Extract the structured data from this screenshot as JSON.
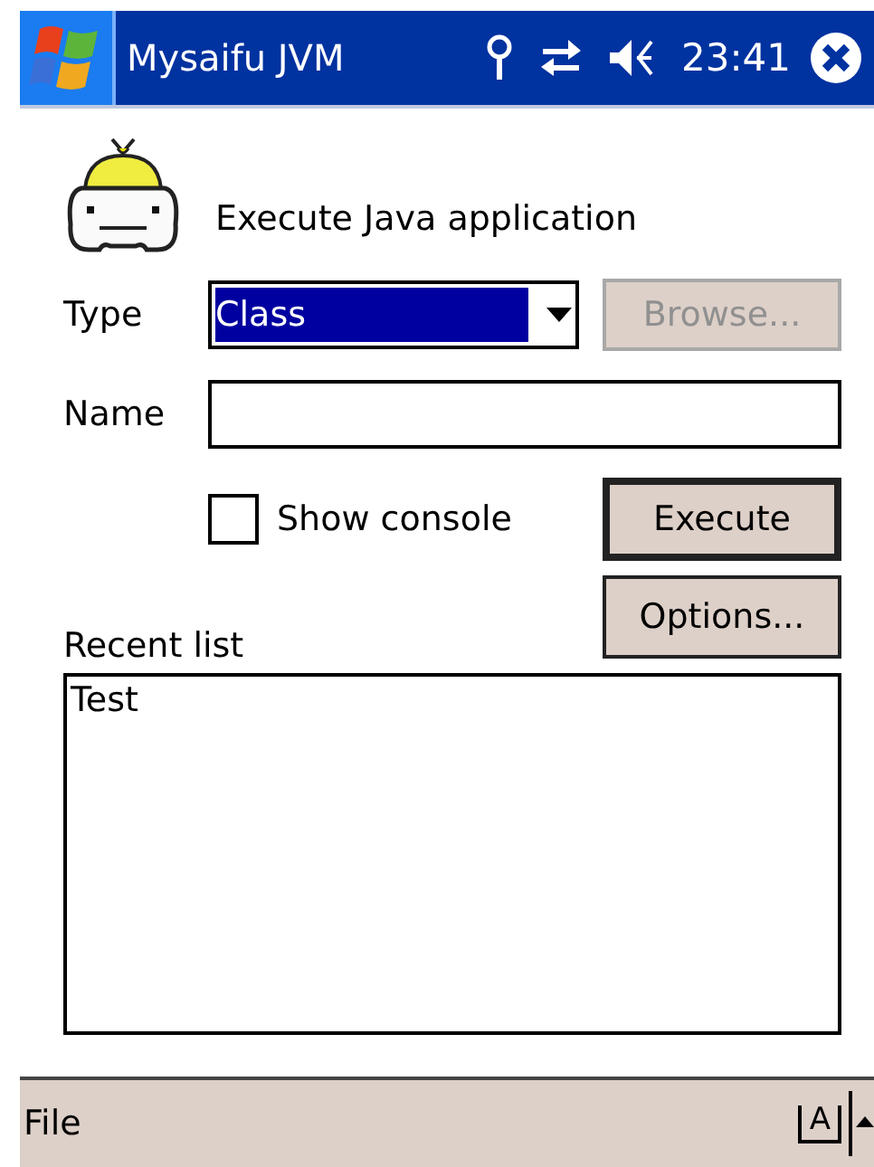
{
  "title_bar": {
    "title": "Mysaifu JVM",
    "time": "23:41"
  },
  "header": {
    "text": "Execute Java application"
  },
  "type_field": {
    "label": "Type",
    "value": "Class",
    "selected": true
  },
  "browse_button": {
    "label": "Browse...",
    "disabled": true
  },
  "name_field": {
    "label": "Name"
  },
  "show_console": {
    "label": "Show console",
    "checked": false
  },
  "execute_button": {
    "label": "Execute",
    "default": true
  },
  "options_button": {
    "label": "Options...",
    "default": false
  },
  "recent_list": {
    "label": "Recent list",
    "items": [
      {
        "text": "Test",
        "selected": false
      }
    ]
  },
  "menu_bar": {
    "items": [
      "File"
    ],
    "input_panel": "A"
  }
}
